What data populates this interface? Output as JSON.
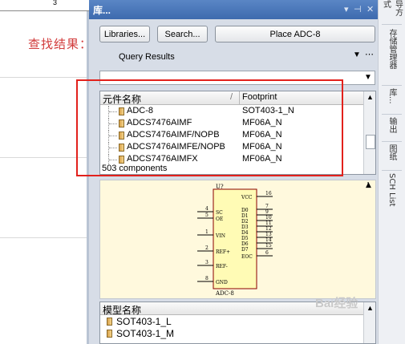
{
  "sheet": {
    "ruler_number": "3",
    "annotation": "查找结果："
  },
  "panel": {
    "title": "库...",
    "buttons": {
      "libraries": "Libraries...",
      "search": "Search...",
      "place": "Place ADC-8"
    },
    "source_combo": "Query Results",
    "filter_combo": ""
  },
  "list": {
    "headers": [
      "元件名称",
      "Footprint"
    ],
    "rows": [
      {
        "name": "ADC-8",
        "footprint": "SOT403-1_N"
      },
      {
        "name": "ADCS7476AIMF",
        "footprint": "MF06A_N"
      },
      {
        "name": "ADCS7476AIMF/NOPB",
        "footprint": "MF06A_N"
      },
      {
        "name": "ADCS7476AIMFE/NOPB",
        "footprint": "MF06A_N"
      },
      {
        "name": "ADCS7476AIMFX",
        "footprint": "MF06A_N"
      }
    ],
    "count": "503 components"
  },
  "preview": {
    "ref": "U?",
    "part": "ADC-8",
    "left_pins": [
      {
        "num": "4",
        "name": "SC"
      },
      {
        "num": "5",
        "name": "OE"
      },
      {
        "num": "1",
        "name": "VIN"
      },
      {
        "num": "2",
        "name": "REF+"
      },
      {
        "num": "3",
        "name": "REF-"
      },
      {
        "num": "8",
        "name": "GND"
      }
    ],
    "right_pins": [
      {
        "num": "16",
        "name": "VCC"
      },
      {
        "num": "7",
        "name": "D0"
      },
      {
        "num": "9",
        "name": "D1"
      },
      {
        "num": "10",
        "name": "D2"
      },
      {
        "num": "11",
        "name": "D3"
      },
      {
        "num": "12",
        "name": "D4"
      },
      {
        "num": "13",
        "name": "D5"
      },
      {
        "num": "14",
        "name": "D6"
      },
      {
        "num": "15",
        "name": "D7"
      },
      {
        "num": "6",
        "name": "EOC"
      }
    ]
  },
  "model": {
    "header": "模型名称",
    "rows": [
      "SOT403-1_L",
      "SOT403-1_M"
    ]
  },
  "right_tabs": [
    "导方式",
    "存储管理器",
    "库...",
    "输出",
    "图纸",
    "SCH List"
  ],
  "watermark": "Bai经验"
}
